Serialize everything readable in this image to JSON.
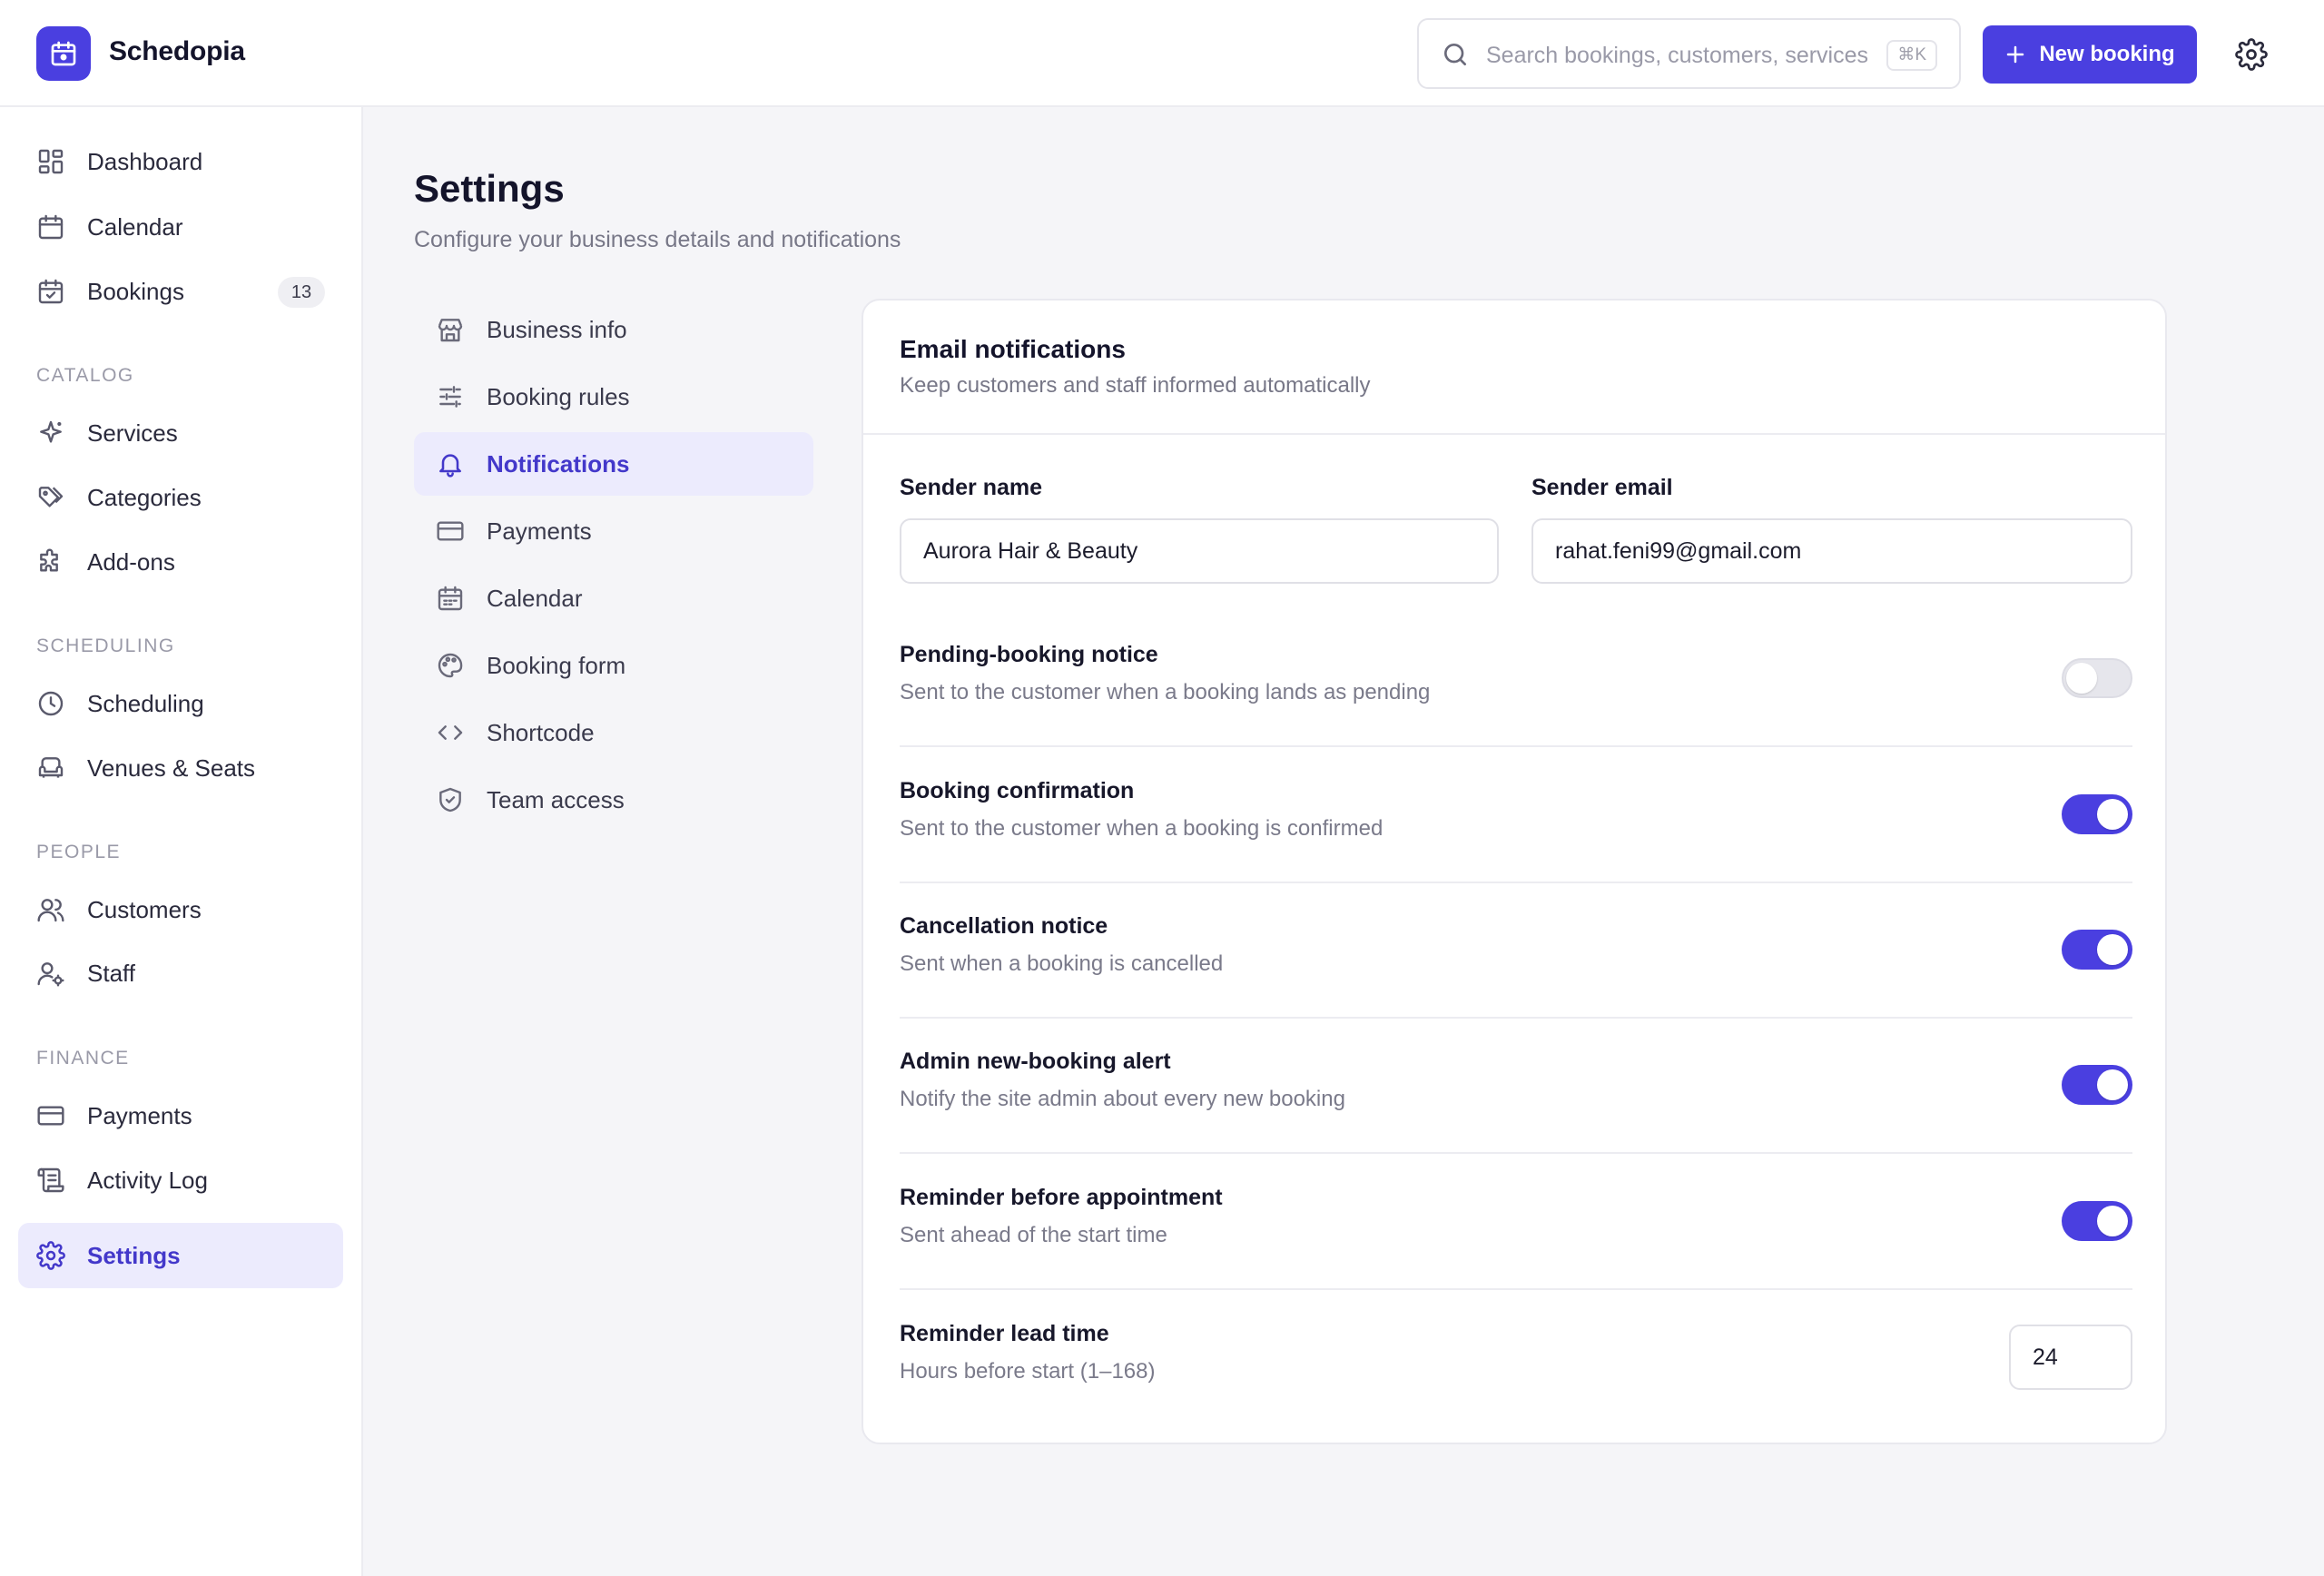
{
  "app": {
    "brand": "Schedopia"
  },
  "search": {
    "placeholder": "Search bookings, customers, services",
    "shortcut": "⌘K"
  },
  "header": {
    "new_booking_label": "New booking"
  },
  "sidebar": {
    "items": [
      {
        "label": "Dashboard",
        "icon": "dashboard-icon"
      },
      {
        "label": "Calendar",
        "icon": "calendar-icon"
      },
      {
        "label": "Bookings",
        "icon": "calendar-check-icon",
        "badge": "13"
      }
    ],
    "sections": [
      {
        "label": "CATALOG",
        "items": [
          {
            "label": "Services",
            "icon": "sparkle-icon"
          },
          {
            "label": "Categories",
            "icon": "tags-icon"
          },
          {
            "label": "Add-ons",
            "icon": "puzzle-icon"
          }
        ]
      },
      {
        "label": "SCHEDULING",
        "items": [
          {
            "label": "Scheduling",
            "icon": "clock-icon"
          },
          {
            "label": "Venues & Seats",
            "icon": "armchair-icon"
          }
        ]
      },
      {
        "label": "PEOPLE",
        "items": [
          {
            "label": "Customers",
            "icon": "users-icon"
          },
          {
            "label": "Staff",
            "icon": "user-cog-icon"
          }
        ]
      },
      {
        "label": "FINANCE",
        "items": [
          {
            "label": "Payments",
            "icon": "credit-card-icon"
          },
          {
            "label": "Activity Log",
            "icon": "scroll-icon"
          }
        ]
      }
    ],
    "settings": {
      "label": "Settings",
      "icon": "gear-icon",
      "active": true
    }
  },
  "page": {
    "title": "Settings",
    "subtitle": "Configure your business details and notifications"
  },
  "settings_nav": [
    {
      "label": "Business info",
      "icon": "store-icon"
    },
    {
      "label": "Booking rules",
      "icon": "sliders-icon"
    },
    {
      "label": "Notifications",
      "icon": "bell-icon",
      "active": true
    },
    {
      "label": "Payments",
      "icon": "credit-card-icon"
    },
    {
      "label": "Calendar",
      "icon": "calendar-icon"
    },
    {
      "label": "Booking form",
      "icon": "palette-icon"
    },
    {
      "label": "Shortcode",
      "icon": "code-icon"
    },
    {
      "label": "Team access",
      "icon": "shield-check-icon"
    }
  ],
  "card": {
    "title": "Email notifications",
    "description": "Keep customers and staff informed automatically",
    "sender_name_label": "Sender name",
    "sender_name_value": "Aurora Hair & Beauty",
    "sender_email_label": "Sender email",
    "sender_email_value": "rahat.feni99@gmail.com",
    "toggles": [
      {
        "title": "Pending-booking notice",
        "description": "Sent to the customer when a booking lands as pending",
        "on": false
      },
      {
        "title": "Booking confirmation",
        "description": "Sent to the customer when a booking is confirmed",
        "on": true
      },
      {
        "title": "Cancellation notice",
        "description": "Sent when a booking is cancelled",
        "on": true
      },
      {
        "title": "Admin new-booking alert",
        "description": "Notify the site admin about every new booking",
        "on": true
      },
      {
        "title": "Reminder before appointment",
        "description": "Sent ahead of the start time",
        "on": true
      }
    ],
    "lead_time": {
      "title": "Reminder lead time",
      "description": "Hours before start (1–168)",
      "value": "24"
    }
  },
  "colors": {
    "accent": "#4a3fe0",
    "accent_soft": "#ecebfd",
    "accent_text": "#4338ca"
  }
}
